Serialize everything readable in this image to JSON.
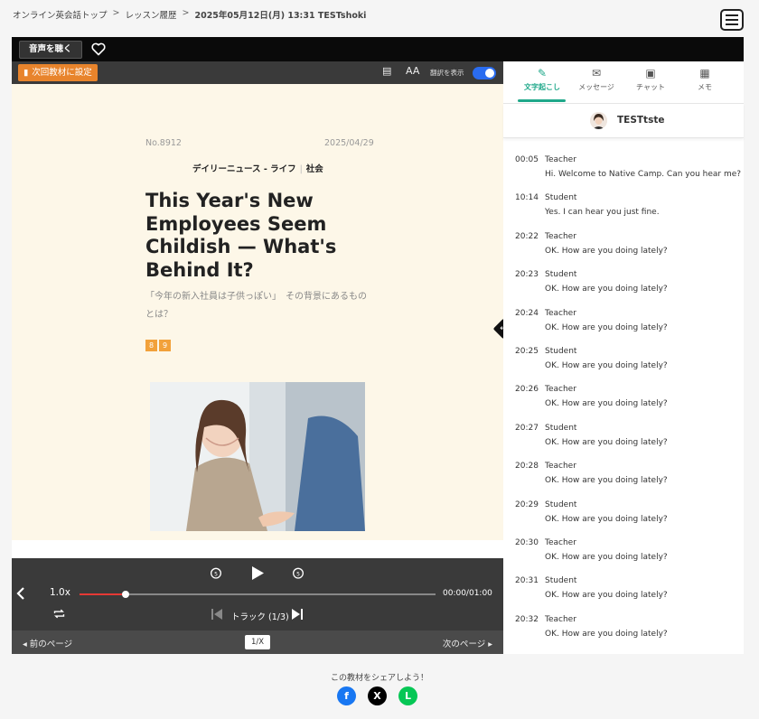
{
  "breadcrumb": {
    "home": "オンライン英会話トップ",
    "history": "レッスン履歴",
    "current": "2025年05月12日(月) 13:31 TESTshoki",
    "separator": ">"
  },
  "topbar": {
    "listen_label": "音声を聴く"
  },
  "toolbar": {
    "next_material_label": "次回教材に設定",
    "font_size_label": "AA",
    "translation_label": "翻訳を表示",
    "translation_on": true
  },
  "article": {
    "number": "No.8912",
    "date": "2025/04/29",
    "category_main": "デイリーニュース - ライフ",
    "category_sub": "社会",
    "title": "This Year's New Employees Seem Childish — What's Behind It?",
    "subtitle": "「今年の新入社員は子供っぽい」　その背景にあるものとは？",
    "levels": [
      "8",
      "9"
    ]
  },
  "player": {
    "speed": "1.0x",
    "time": "00:00/01:00",
    "track_label": "トラック (1/3)",
    "progress": 0.13,
    "accent": "#e53935"
  },
  "pager": {
    "prev_label": "前のページ",
    "next_label": "次のページ",
    "page": "1/X"
  },
  "side_tabs": [
    {
      "label": "文字起こし",
      "icon": "transcript-icon",
      "active": true
    },
    {
      "label": "メッセージ",
      "icon": "message-icon",
      "active": false
    },
    {
      "label": "チャット",
      "icon": "chat-icon",
      "active": false
    },
    {
      "label": "メモ",
      "icon": "memo-icon",
      "active": false
    }
  ],
  "user": {
    "name": "TESTtste"
  },
  "transcript": [
    {
      "time": "00:05",
      "speaker": "Teacher",
      "text": "Hi. Welcome to Native Camp. Can you hear me?"
    },
    {
      "time": "10:14",
      "speaker": "Student",
      "text": "Yes. I can hear you just fine."
    },
    {
      "time": "20:22",
      "speaker": "Teacher",
      "text": "OK. How are you doing lately?"
    },
    {
      "time": "20:23",
      "speaker": "Student",
      "text": "OK. How are you doing lately?"
    },
    {
      "time": "20:24",
      "speaker": "Teacher",
      "text": "OK. How are you doing lately?"
    },
    {
      "time": "20:25",
      "speaker": "Student",
      "text": "OK. How are you doing lately?"
    },
    {
      "time": "20:26",
      "speaker": "Teacher",
      "text": "OK. How are you doing lately?"
    },
    {
      "time": "20:27",
      "speaker": "Student",
      "text": "OK. How are you doing lately?"
    },
    {
      "time": "20:28",
      "speaker": "Teacher",
      "text": "OK. How are you doing lately?"
    },
    {
      "time": "20:29",
      "speaker": "Student",
      "text": "OK. How are you doing lately?"
    },
    {
      "time": "20:30",
      "speaker": "Teacher",
      "text": "OK. How are you doing lately?"
    },
    {
      "time": "20:31",
      "speaker": "Student",
      "text": "OK. How are you doing lately?"
    },
    {
      "time": "20:32",
      "speaker": "Teacher",
      "text": "OK. How are you doing lately?"
    }
  ],
  "share": {
    "label": "この教材をシェアしよう！",
    "networks": [
      {
        "name": "facebook-icon",
        "glyph": "f",
        "color": "#1877f2"
      },
      {
        "name": "x-icon",
        "glyph": "X",
        "color": "#000000"
      },
      {
        "name": "line-icon",
        "glyph": "L",
        "color": "#06c755"
      }
    ]
  },
  "colors": {
    "accent_green": "#1fa88a",
    "orange": "#e8842c",
    "paper": "#fdf7e8"
  }
}
